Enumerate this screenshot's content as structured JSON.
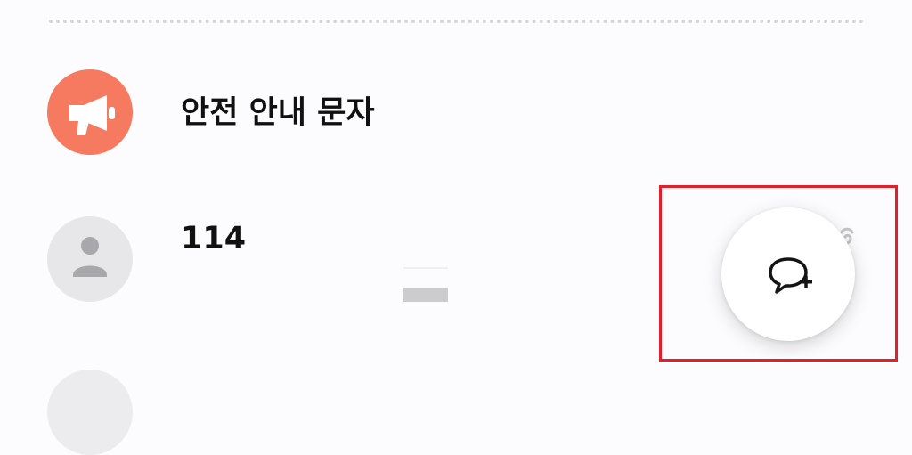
{
  "conversations": [
    {
      "title": "안전 안내 문자",
      "avatar_icon": "megaphone-icon",
      "avatar_color": "#f57a5f"
    },
    {
      "title": "114",
      "avatar_icon": "person-icon",
      "avatar_color": "#e7e7ea"
    }
  ],
  "fab": {
    "icon": "new-chat-icon"
  },
  "highlight": {
    "color": "#e41f2c"
  }
}
